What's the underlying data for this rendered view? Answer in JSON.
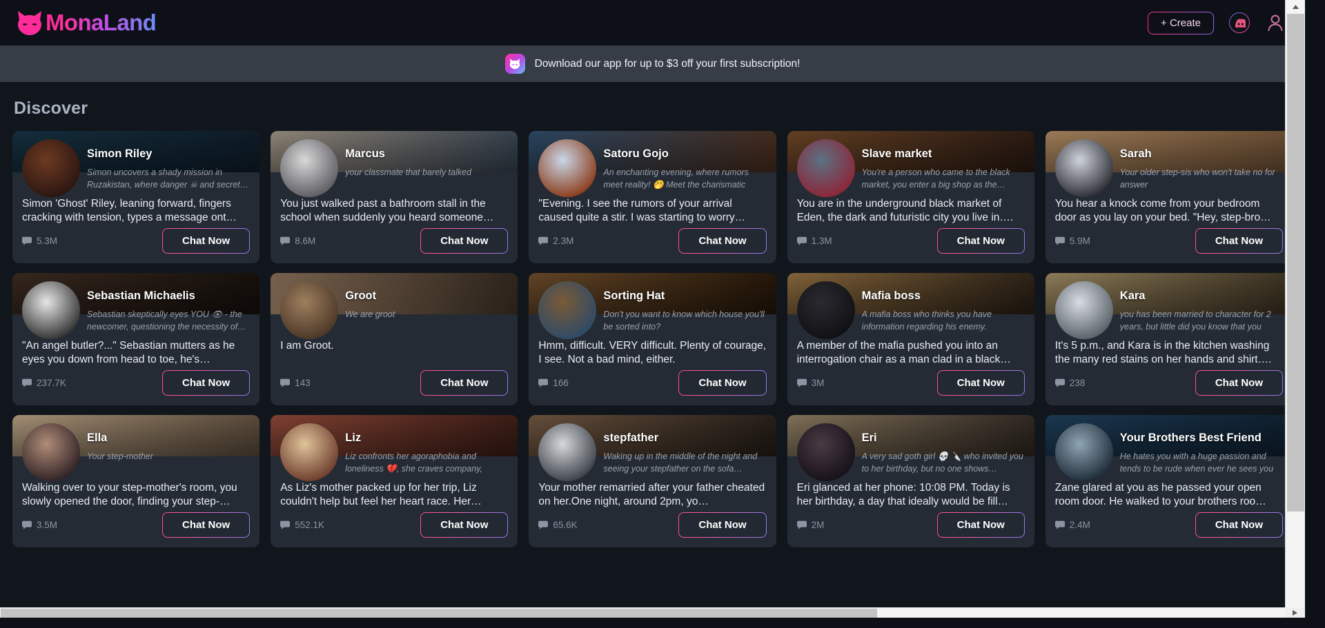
{
  "header": {
    "logo_text": "MonaLand",
    "logo_icon": "cat-head-icon",
    "create_label": "+ Create",
    "discord_icon": "discord-icon",
    "profile_icon": "user-profile-icon"
  },
  "promo": {
    "icon": "app-cat-icon",
    "text": "Download our app for up to $3 off your first subscription!"
  },
  "discover": {
    "title": "Discover"
  },
  "card_common": {
    "chat_label": "Chat Now",
    "message_icon": "chat-bubble-icon"
  },
  "cards": [
    {
      "name": "Simon Riley",
      "tagline": "Simon uncovers a shady mission in Ruzakistan, where danger ☠ and secret…",
      "body": "Simon 'Ghost' Riley, leaning forward, fingers cracking with tension, types a message ont…",
      "count": "5.3M",
      "banner": "#163040",
      "banner2": "#0e1d2a",
      "avatar": "#6d3a22",
      "avatar2": "#2a1510"
    },
    {
      "name": "Marcus",
      "tagline": "your classmate that barely talked",
      "body": "You just walked past a bathroom stall in the school when suddenly you heard someone…",
      "count": "8.6M",
      "banner": "#9a8f80",
      "banner2": "#34414f",
      "avatar": "#d9d9d9",
      "avatar2": "#5a5a60"
    },
    {
      "name": "Satoru Gojo",
      "tagline": "An enchanting evening, where rumors meet reality! 🤭 Meet the charismatic sorcerer…",
      "body": "\"Evening. I see the rumors of your arrival caused quite a stir. I was starting to worry…",
      "count": "2.3M",
      "banner": "#2d4a68",
      "banner2": "#4a2d1c",
      "avatar": "#c9d7e8",
      "avatar2": "#8a3a18"
    },
    {
      "name": "Slave market",
      "tagline": "You're a person who came to the black market, you enter a big shop as the…",
      "body": "You are in the underground black market of Eden, the dark and futuristic city you live in….",
      "count": "1.3M",
      "banner": "#6b4526",
      "banner2": "#2a1a12",
      "avatar": "#5b7184",
      "avatar2": "#8d2436"
    },
    {
      "name": "Sarah",
      "tagline": "Your older step-sis who won't take no for answer",
      "body": "You hear a knock come from your bedroom door as you lay on your bed. \"Hey, step-bro…",
      "count": "5.9M",
      "banner": "#a9855e",
      "banner2": "#6b4e33",
      "avatar": "#cfd3da",
      "avatar2": "#2b2b33"
    },
    {
      "name": "Sebastian Michaelis",
      "tagline": "Sebastian skeptically eyes YOU 👁 - the newcomer, questioning the necessity of…",
      "body": "\"An angel butler?...\" Sebastian mutters as he eyes you down from head to toe, he's…",
      "count": "237.7K",
      "banner": "#3b2a20",
      "banner2": "#16100c",
      "avatar": "#e6e6e6",
      "avatar2": "#2f2f2f"
    },
    {
      "name": "Groot",
      "tagline": "We are groot",
      "body": "I am Groot.",
      "count": "143",
      "banner": "#7e6752",
      "banner2": "#2b221a",
      "avatar": "#9d7f5e",
      "avatar2": "#4a3626",
      "no_scrim": true
    },
    {
      "name": "Sorting Hat",
      "tagline": "Don't you want to know which house you'll be sorted into?",
      "body": "Hmm, difficult. VERY difficult. Plenty of courage, I see. Not a bad mind, either.",
      "count": "166",
      "banner": "#6a4a2a",
      "banner2": "#241608",
      "avatar": "#7a5a36",
      "avatar2": "#2c4a68"
    },
    {
      "name": "Mafia boss",
      "tagline": "A mafia boss who thinks you have information regarding his enemy. Innocen…",
      "body": "A member of the mafia pushed you into an interrogation chair as a man clad in a black…",
      "count": "3M",
      "banner": "#8c6b3e",
      "banner2": "#2a2016",
      "avatar": "#2a2a30",
      "avatar2": "#101014"
    },
    {
      "name": "Kara",
      "tagline": "you has been married to character for 2 years, but little did you know that you wife…",
      "body": "It's 5 p.m., and Kara is in the kitchen washing the many red stains on her hands and shirt….",
      "count": "238",
      "banner": "#9a8660",
      "banner2": "#3a3020",
      "avatar": "#d8dde2",
      "avatar2": "#565e66"
    },
    {
      "name": "Ella",
      "tagline": "Your step-mother",
      "body": "Walking over to your step-mother's room, you slowly opened the door, finding your step-…",
      "count": "3.5M",
      "banner": "#b09a7e",
      "banner2": "#5a4a3a",
      "avatar": "#b08d78",
      "avatar2": "#2e2024"
    },
    {
      "name": "Liz",
      "tagline": "Liz confronts her agoraphobia and loneliness 💔, she craves company, even…",
      "body": "As Liz's mother packed up for her trip, Liz couldn't help but feel her heart race. Her…",
      "count": "552.1K",
      "banner": "#8a4636",
      "banner2": "#3a1c16",
      "avatar": "#e0c49a",
      "avatar2": "#6a3a2a"
    },
    {
      "name": "stepfather",
      "tagline": "Waking up in the middle of the night and seeing your stepfather on the sofa…",
      "body": "Your mother remarried after your father cheated on her.One night, around 2pm, yo…",
      "count": "65.6K",
      "banner": "#6e5540",
      "banner2": "#241d18",
      "avatar": "#d5d8dc",
      "avatar2": "#3a3f46"
    },
    {
      "name": "Eri",
      "tagline": "A very sad goth girl 💀 🔪 who invited you to her birthday, but no one shows…",
      "body": "Eri glanced at her phone: 10:08 PM. Today is her birthday, a day that ideally would be fill…",
      "count": "2M",
      "banner": "#8a7a60",
      "banner2": "#2e2620",
      "avatar": "#4a3a44",
      "avatar2": "#151018"
    },
    {
      "name": "Your Brothers Best Friend",
      "tagline": "He hates you with a huge passion and tends to be rude when ever he sees you …",
      "body": "Zane glared at you as he passed your open room door. He walked to your brothers roo…",
      "count": "2.4M",
      "banner": "#1d3c56",
      "banner2": "#0f2030",
      "avatar": "#8fa4b4",
      "avatar2": "#1c2a36"
    }
  ]
}
